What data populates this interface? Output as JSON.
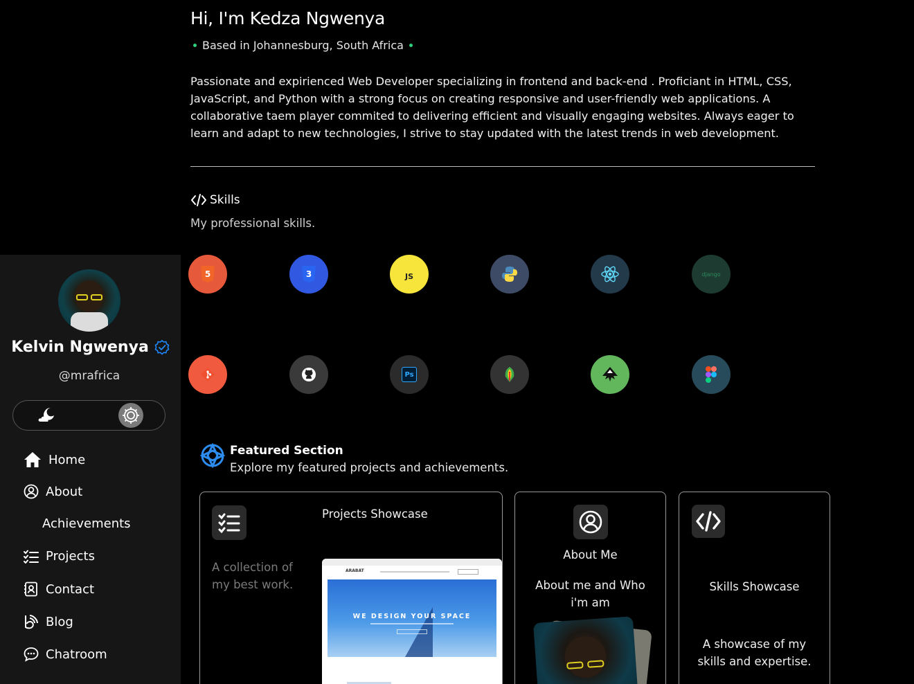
{
  "hero": {
    "title": "Hi, I'm Kedza Ngwenya",
    "location": "Based in Johannesburg, South Africa",
    "bio": "Passionate and expirienced Web Developer specializing in frontend and back-end . Proficiant in HTML, CSS, JavaScript, and Python with a strong focus on creating responsive and user-friendly web applications. A collaborative taem player commited to delivering efficient and visually engaging websites. Always eager to learn and adapt to new technologies, I strive to stay updated with the latest trends in web development."
  },
  "skills": {
    "heading": "Skills",
    "subheading": "My professional skills.",
    "items": [
      {
        "name": "html5-icon",
        "glyph": "5",
        "bg": "#e34f26"
      },
      {
        "name": "css3-icon",
        "glyph": "3",
        "bg": "#2f5fe0"
      },
      {
        "name": "javascript-icon",
        "glyph": "JS",
        "bg": "#f7e23a"
      },
      {
        "name": "python-icon",
        "glyph": "",
        "bg": "#3b4a66"
      },
      {
        "name": "react-icon",
        "glyph": "",
        "bg": "#24394a"
      },
      {
        "name": "django-icon",
        "glyph": "django",
        "bg": "#1f3d33"
      },
      {
        "name": "git-icon",
        "glyph": "",
        "bg": "#f05033"
      },
      {
        "name": "github-icon",
        "glyph": "",
        "bg": "#3a3a3a"
      },
      {
        "name": "photoshop-icon",
        "glyph": "Ps",
        "bg": "#2d2d2d"
      },
      {
        "name": "coreldraw-icon",
        "glyph": "",
        "bg": "#333333"
      },
      {
        "name": "inkscape-icon",
        "glyph": "",
        "bg": "#5fb35a"
      },
      {
        "name": "figma-icon",
        "glyph": "",
        "bg": "#274a5a"
      }
    ]
  },
  "featured": {
    "title": "Featured Section",
    "subtitle": "Explore my featured projects and achievements.",
    "cards": [
      {
        "title": "Projects Showcase",
        "text": "A collection of my best work.",
        "preview_brand": "ARABAT",
        "preview_headline": "WE DESIGN YOUR SPACE"
      },
      {
        "title": "About Me",
        "text": "About me and Who i'm am"
      },
      {
        "title": "Skills Showcase",
        "text": "A showcase of my skills and expertise."
      }
    ]
  },
  "sidebar": {
    "name": "Kelvin Ngwenya",
    "handle": "@mrafrica",
    "nav": [
      {
        "label": "Home",
        "icon": "home-icon"
      },
      {
        "label": "About",
        "icon": "user-circle-icon"
      },
      {
        "label": "Achievements",
        "icon": ""
      },
      {
        "label": "Projects",
        "icon": "checklist-icon"
      },
      {
        "label": "Contact",
        "icon": "contact-card-icon"
      },
      {
        "label": "Blog",
        "icon": "blog-icon"
      },
      {
        "label": "Chatroom",
        "icon": "chat-icon"
      }
    ]
  },
  "colors": {
    "accent": "#2bd17e",
    "verified": "#1e88ff",
    "background": "#000000",
    "sidebar": "#161616"
  }
}
